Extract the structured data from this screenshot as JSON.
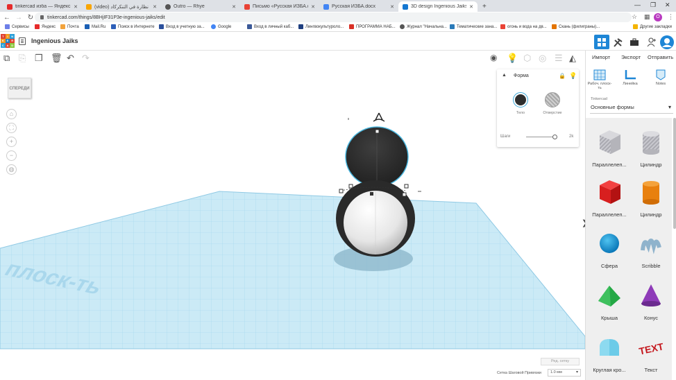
{
  "browser": {
    "tabs": [
      {
        "title": "tinkercad изба — Яндекс: нашл...",
        "color": "#e62b2b"
      },
      {
        "title": "(video) تصميم نظارة في التنكركاد",
        "color": "#f9a500"
      },
      {
        "title": "Outro — Rhye",
        "color": "#555555"
      },
      {
        "title": "Письмо «Русская ИЗБА.docx» ...",
        "color": "#e94235"
      },
      {
        "title": "Русская ИЗБА.docx",
        "color": "#4285f4"
      },
      {
        "title": "3D design Ingenious Jaiks | Tink...",
        "color": "#1477d1"
      }
    ],
    "new_tab": "+",
    "url": "tinkercad.com/things/8BHjIF31P3e-ingenious-jaiks/edit",
    "profile_initial": "O",
    "bookmarks": [
      {
        "label": "Сервисы",
        "color": "#6d7fe8"
      },
      {
        "label": "Яндекс",
        "color": "#e62b2b"
      },
      {
        "label": "Почта",
        "color": "#f2a33c"
      },
      {
        "label": "Mail.Ru",
        "color": "#1a5fb4"
      },
      {
        "label": "Поиск в Интернете",
        "color": "#2c5fb9"
      },
      {
        "label": "Вход в учетную за...",
        "color": "#2a4f9c"
      },
      {
        "label": "Google",
        "color": "#4285f4"
      },
      {
        "label": "Вход в личный каб...",
        "color": "#3b5998"
      },
      {
        "label": "Лингвокультуроло...",
        "color": "#1f3f80"
      },
      {
        "label": "ПРОГРАММА НАБ...",
        "color": "#d93025"
      },
      {
        "label": "Журнал \"Начальна...",
        "color": "#555555"
      },
      {
        "label": "Тематические зана...",
        "color": "#2a7ab9"
      },
      {
        "label": "огонь и вода на дв...",
        "color": "#e94235"
      },
      {
        "label": "Скань (филиграны)...",
        "color": "#e37400"
      }
    ],
    "other_bookmarks": "Другие закладки"
  },
  "app": {
    "logo_letters": [
      "TIN",
      "KER",
      "CAD"
    ],
    "design_title": "Ingenious Jaiks",
    "actions": {
      "import": "Импорт",
      "export": "Экспорт",
      "send": "Отправить"
    },
    "view_cube": "СПЕРЕДИ",
    "workplane_text": "Рабоч. плоск-ть"
  },
  "shape_panel": {
    "title": "Форма",
    "solid_label": "Тело",
    "hole_label": "Отверстие",
    "steps_label": "Шаги",
    "steps_value": "2k"
  },
  "right_panel": {
    "tool_tabs": [
      {
        "label": "Рабоч. плоск-ть"
      },
      {
        "label": "Линейка"
      },
      {
        "label": "Notes"
      }
    ],
    "library_small": "Tinkercad",
    "library_name": "Основные формы",
    "shapes": [
      {
        "label": "Параллелеп...",
        "icon": "striped-box-icon"
      },
      {
        "label": "Цилиндр",
        "icon": "striped-cylinder-icon"
      },
      {
        "label": "Параллелеп...",
        "icon": "red-box-icon"
      },
      {
        "label": "Цилиндр",
        "icon": "orange-cylinder-icon"
      },
      {
        "label": "Сфера",
        "icon": "blue-sphere-icon"
      },
      {
        "label": "Scribble",
        "icon": "scribble-icon"
      },
      {
        "label": "Крыша",
        "icon": "green-roof-icon"
      },
      {
        "label": "Конус",
        "icon": "purple-cone-icon"
      },
      {
        "label": "Круглая кро...",
        "icon": "round-roof-icon"
      },
      {
        "label": "Текст",
        "icon": "red-text-icon"
      }
    ]
  },
  "bottom": {
    "ruler_button": "Ред. сетку",
    "snap_label": "Сетка Шаговой Привязки",
    "snap_value": "1.0 мм"
  },
  "colors": {
    "accent": "#1477d1",
    "grid": "#bfe4f4",
    "selection": "#4bb8e0",
    "sphere_dark": "#2e2e2e"
  }
}
